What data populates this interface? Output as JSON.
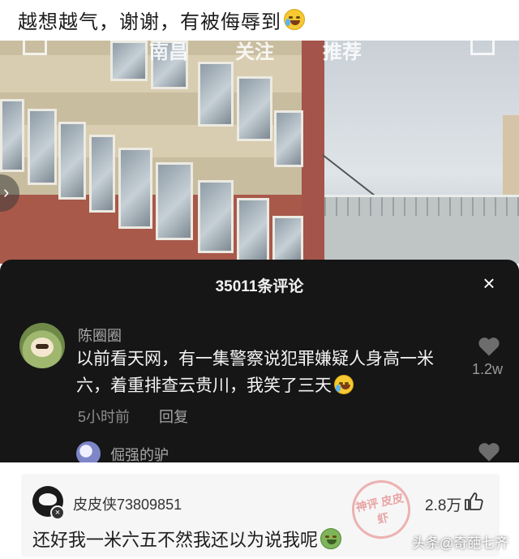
{
  "post": {
    "title": "越想越气，谢谢，有被侮辱到",
    "title_emoji": "crying-laughing-face"
  },
  "video": {
    "nav_tabs": [
      "南昌",
      "关注",
      "推荐"
    ]
  },
  "comments_panel": {
    "title": "35011条评论",
    "close_label": "×",
    "comments": [
      {
        "user": "陈圈圈",
        "text": "以前看天网，有一集警察说犯罪嫌疑人身高一米六，着重排查云贵川，我笑了三天",
        "emoji": "crying-laughing-face",
        "time": "5小时前",
        "reply_label": "回复",
        "likes": "1.2w"
      },
      {
        "user": "倔强的驴"
      }
    ]
  },
  "highlight_card": {
    "user": "皮皮侠73809851",
    "likes": "2.8万",
    "text": "还好我一米六五不然我还以为说我呢",
    "emoji": "sick-face",
    "stamp_text": "神评 皮皮虾"
  },
  "watermark": "头条@奇葩七齐",
  "colors": {
    "panel_bg": "#161616",
    "card_bg": "#f6f6f6",
    "stamp": "#e06e6e"
  }
}
